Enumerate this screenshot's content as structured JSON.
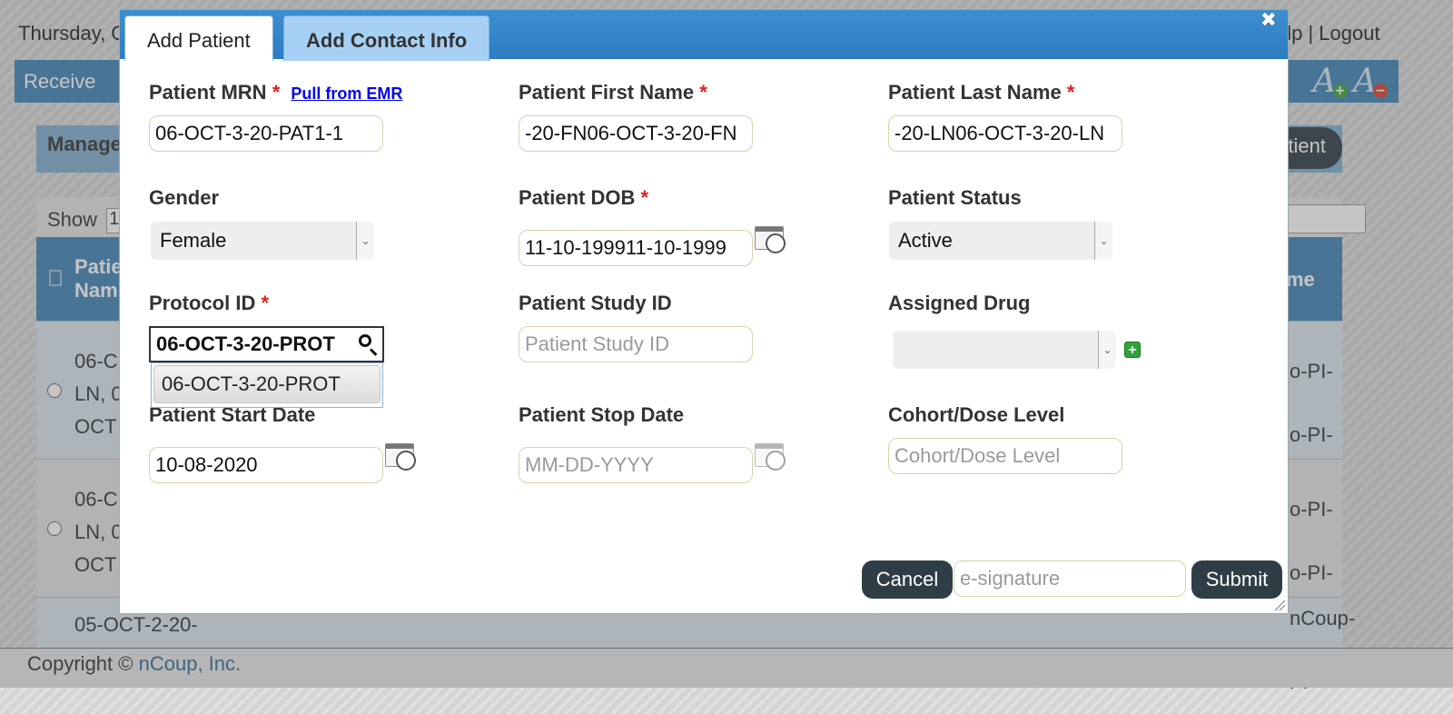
{
  "background": {
    "date_text": "Thursday, O",
    "header_links": "elp | Logout",
    "nav_receive": "Receive",
    "manage_text": "Manage",
    "add_patient_partial": "tient",
    "show_label": "Show",
    "show_value": "1",
    "col_patient_name": "Patie\nNam",
    "col_right": "me",
    "rows": [
      {
        "text": "06-C\nLN, 0\nOCT",
        "right": "o-PI-\no-PI-"
      },
      {
        "text": "06-C\nLN, 0\nOCT",
        "right": "o-PI-\no-PI-"
      },
      {
        "text": "05-OCT-2-20-",
        "right": "nCoup-PI-"
      }
    ],
    "footer_copyright": "Copyright ©",
    "footer_company": "nCoup, Inc."
  },
  "dialog": {
    "tabs": {
      "add_patient": "Add Patient",
      "add_contact_info": "Add Contact Info"
    },
    "close_symbol": "✖",
    "fields": {
      "mrn": {
        "label": "Patient MRN",
        "required": "*",
        "link": "Pull from EMR",
        "value": "06-OCT-3-20-PAT1-1"
      },
      "first_name": {
        "label": "Patient First Name",
        "required": "*",
        "value": "-20-FN06-OCT-3-20-FN"
      },
      "last_name": {
        "label": "Patient Last Name",
        "required": "*",
        "value": "-20-LN06-OCT-3-20-LN"
      },
      "gender": {
        "label": "Gender",
        "value": "Female"
      },
      "dob": {
        "label": "Patient DOB",
        "required": "*",
        "value": "11-10-199911-10-1999"
      },
      "status": {
        "label": "Patient Status",
        "value": "Active"
      },
      "protocol": {
        "label": "Protocol ID",
        "required": "*",
        "value": "06-OCT-3-20-PROT",
        "suggestion": "06-OCT-3-20-PROT"
      },
      "study_id": {
        "label": "Patient Study ID",
        "placeholder": "Patient Study ID"
      },
      "assigned_drug": {
        "label": "Assigned Drug",
        "value": ""
      },
      "start_date": {
        "label": "Patient Start Date",
        "value": "10-08-2020"
      },
      "stop_date": {
        "label": "Patient Stop Date",
        "placeholder": "MM-DD-YYYY"
      },
      "cohort": {
        "label": "Cohort/Dose Level",
        "placeholder": "Cohort/Dose Level"
      }
    },
    "actions": {
      "cancel": "Cancel",
      "esignature_placeholder": "e-signature",
      "submit": "Submit"
    }
  },
  "colors": {
    "header_blue": "#2d7cc1",
    "tab_inactive": "#a7d1f4",
    "required_red": "#e12020",
    "button_dark": "#2f3d46",
    "add_green": "#2fa33a"
  }
}
